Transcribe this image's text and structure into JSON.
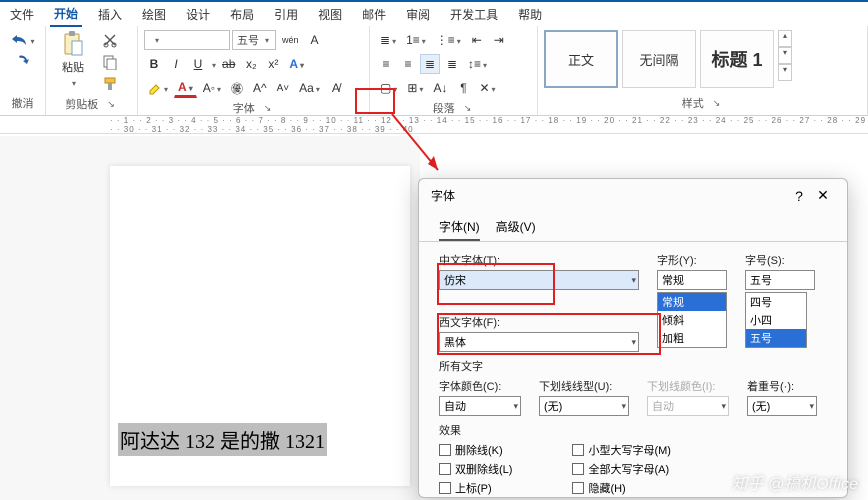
{
  "menubar": [
    "文件",
    "开始",
    "插入",
    "绘图",
    "设计",
    "布局",
    "引用",
    "视图",
    "邮件",
    "审阅",
    "开发工具",
    "帮助"
  ],
  "active_menu_index": 1,
  "ribbon": {
    "undo_label": "撤消",
    "clipboard_label": "剪贴板",
    "paste_label": "粘贴",
    "font_group_label": "字体",
    "font_size_value": "五号",
    "wen_label": "wén",
    "bold": "B",
    "italic": "I",
    "underline": "U",
    "strike": "ab",
    "sub": "x₂",
    "sup": "x²",
    "paragraph_label": "段落",
    "styles_label": "样式",
    "style_normal": "正文",
    "style_nospace": "无间隔",
    "style_h1": "标题 1"
  },
  "document": {
    "selected_text": "阿达达 132 是的撒 1321"
  },
  "dialog": {
    "title": "字体",
    "help": "?",
    "close": "✕",
    "tab_font": "字体(N)",
    "tab_adv": "高级(V)",
    "cn_font_label": "中文字体(T):",
    "cn_font_value": "仿宋",
    "west_font_label": "西文字体(F):",
    "west_font_value": "黑体",
    "style_label": "字形(Y):",
    "style_value": "常规",
    "style_opts": [
      "常规",
      "倾斜",
      "加粗"
    ],
    "size_label": "字号(S):",
    "size_value": "五号",
    "size_opts": [
      "四号",
      "小四",
      "五号"
    ],
    "all_text": "所有文字",
    "font_color_label": "字体颜色(C):",
    "font_color_value": "自动",
    "under_type_label": "下划线线型(U):",
    "under_type_value": "(无)",
    "under_color_label": "下划线颜色(I):",
    "under_color_value": "自动",
    "emph_label": "着重号(·):",
    "emph_value": "(无)",
    "effects": "效果",
    "e_strike": "删除线(K)",
    "e_dstrike": "双删除线(L)",
    "e_super": "上标(P)",
    "e_small": "小型大写字母(M)",
    "e_allcap": "全部大写字母(A)",
    "e_hidden": "隐藏(H)"
  },
  "watermark": "知乎 @搞机Office"
}
